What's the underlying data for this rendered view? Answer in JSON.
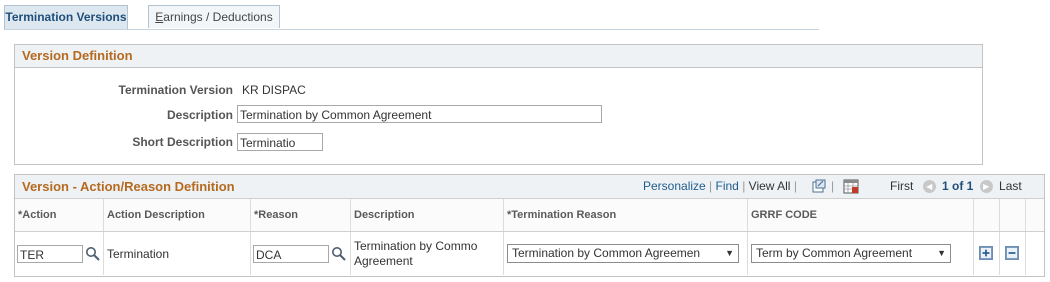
{
  "tabs": [
    {
      "label": "Termination Versions"
    },
    {
      "label_prefix": "E",
      "label_rest": "arnings / Deductions"
    }
  ],
  "version_definition": {
    "header": "Version Definition",
    "termination_version_label": "Termination Version",
    "termination_version_value": "KR DISPAC",
    "description_label": "Description",
    "description_value": "Termination by Common Agreement",
    "short_description_label": "Short Description",
    "short_description_value": "Terminatio"
  },
  "grid": {
    "title": "Version - Action/Reason Definition",
    "personalize": "Personalize",
    "find": "Find",
    "view_all": "View All",
    "first": "First",
    "page_info": "1 of 1",
    "last": "Last",
    "columns": {
      "action": "*Action",
      "action_description": "Action Description",
      "reason": "*Reason",
      "description": "Description",
      "termination_reason": "*Termination Reason",
      "grrf_code": "GRRF CODE"
    },
    "row": {
      "action": "TER",
      "action_description": "Termination",
      "reason": "DCA",
      "description_line1": "Termination by Commo",
      "description_line2": "Agreement",
      "termination_reason": "Termination by Common Agreemen",
      "grrf_code": "Term by Common Agreement"
    }
  },
  "colors": {
    "section_header": "#b56a1f",
    "link": "#1f5d8f",
    "tab_active_bg": "#dde7f0"
  }
}
